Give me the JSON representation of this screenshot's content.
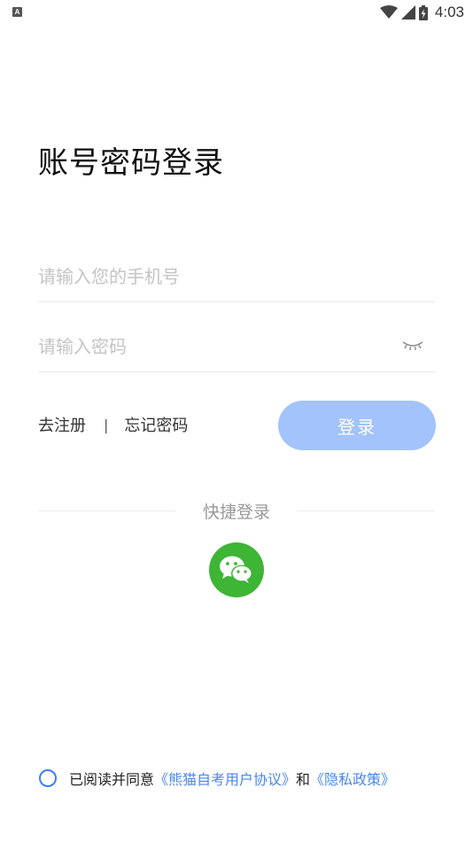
{
  "status_bar": {
    "app_icon_letter": "A",
    "time": "4:03",
    "icons": [
      "wifi-icon",
      "signal-icon",
      "battery-icon"
    ]
  },
  "title": "账号密码登录",
  "phone_input": {
    "placeholder": "请输入您的手机号",
    "value": ""
  },
  "password_input": {
    "placeholder": "请输入密码",
    "value": "",
    "toggle_icon": "eye-closed-icon"
  },
  "links": {
    "register": "去注册",
    "divider": "|",
    "forgot_password": "忘记密码"
  },
  "login_button": {
    "label": "登录",
    "color": "#a3c3fc"
  },
  "quick_login": {
    "title": "快捷登录",
    "wechat_icon": "wechat-icon",
    "wechat_color": "#3eb535"
  },
  "agreement": {
    "prefix": "已阅读并同意",
    "user_agreement": "《熊猫自考用户协议》",
    "conjunction": "和",
    "privacy_policy": "《隐私政策》",
    "link_color": "#4a86f0",
    "checked": false
  }
}
